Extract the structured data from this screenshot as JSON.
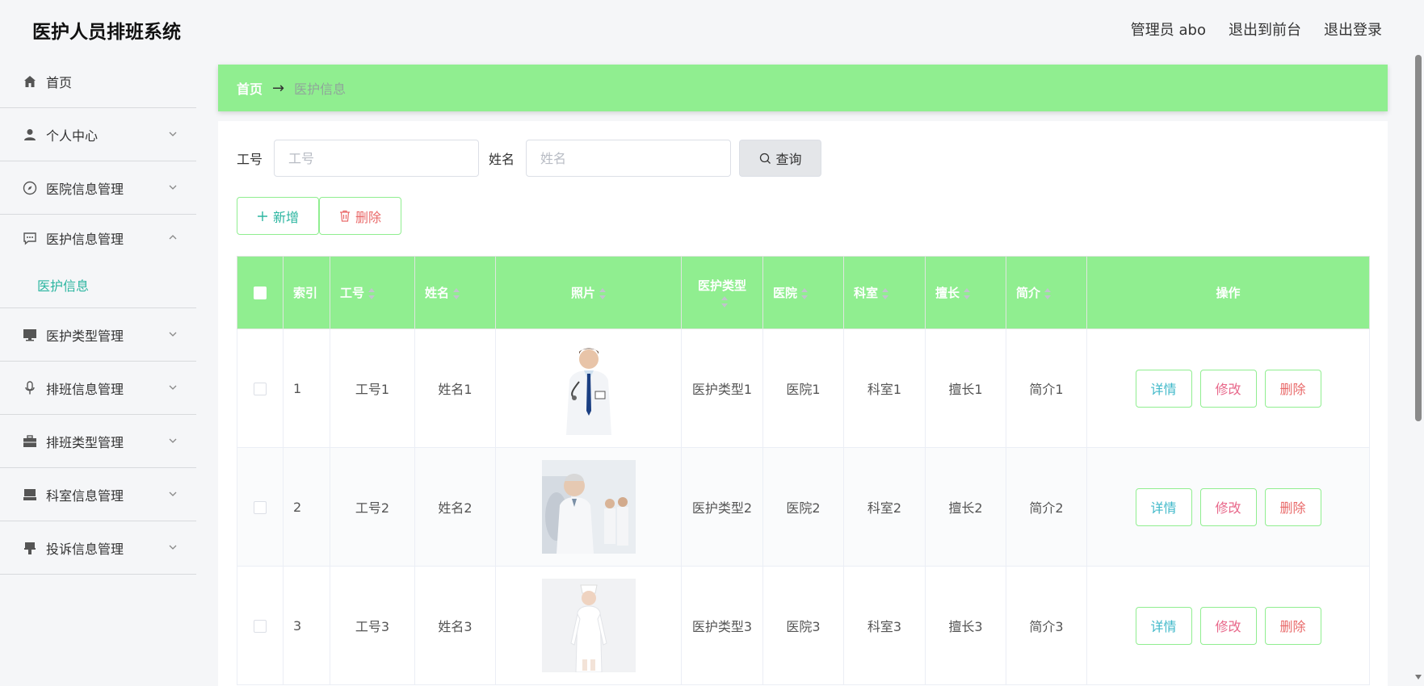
{
  "app": {
    "title": "医护人员排班系统"
  },
  "topbar": {
    "user": "管理员 abo",
    "to_front": "退出到前台",
    "logout": "退出登录"
  },
  "sidebar": {
    "items": [
      {
        "label": "首页",
        "icon": "home-icon"
      },
      {
        "label": "个人中心",
        "icon": "user-icon"
      },
      {
        "label": "医院信息管理",
        "icon": "compass-icon"
      },
      {
        "label": "医护信息管理",
        "icon": "chat-icon",
        "open": true,
        "sub": [
          "医护信息"
        ]
      },
      {
        "label": "医护类型管理",
        "icon": "monitor-icon"
      },
      {
        "label": "排班信息管理",
        "icon": "microphone-icon"
      },
      {
        "label": "排班类型管理",
        "icon": "briefcase-icon"
      },
      {
        "label": "科室信息管理",
        "icon": "tray-icon"
      },
      {
        "label": "投诉信息管理",
        "icon": "stamp-icon"
      }
    ]
  },
  "breadcrumb": {
    "home": "首页",
    "arrow": "→",
    "current": "医护信息"
  },
  "search": {
    "gonghao_label": "工号",
    "gonghao_placeholder": "工号",
    "xingming_label": "姓名",
    "xingming_placeholder": "姓名",
    "query_label": "查询"
  },
  "actions": {
    "add_label": "新增",
    "delete_label": "删除"
  },
  "table": {
    "headers": {
      "index": "索引",
      "gonghao": "工号",
      "xingming": "姓名",
      "photo": "照片",
      "type": "医护类型",
      "hospital": "医院",
      "dept": "科室",
      "specialty": "擅长",
      "intro": "简介",
      "ops": "操作"
    },
    "rows": [
      {
        "index": "1",
        "gonghao": "工号1",
        "xingming": "姓名1",
        "type": "医护类型1",
        "hospital": "医院1",
        "dept": "科室1",
        "specialty": "擅长1",
        "intro": "简介1"
      },
      {
        "index": "2",
        "gonghao": "工号2",
        "xingming": "姓名2",
        "type": "医护类型2",
        "hospital": "医院2",
        "dept": "科室2",
        "specialty": "擅长2",
        "intro": "简介2"
      },
      {
        "index": "3",
        "gonghao": "工号3",
        "xingming": "姓名3",
        "type": "医护类型3",
        "hospital": "医院3",
        "dept": "科室3",
        "specialty": "擅长3",
        "intro": "简介3"
      }
    ],
    "op_labels": {
      "detail": "详情",
      "edit": "修改",
      "delete": "删除"
    }
  },
  "colors": {
    "accent": "#90ee90",
    "teal": "#2bb5a0",
    "danger": "#e96a6a",
    "pink": "#e8678a"
  }
}
